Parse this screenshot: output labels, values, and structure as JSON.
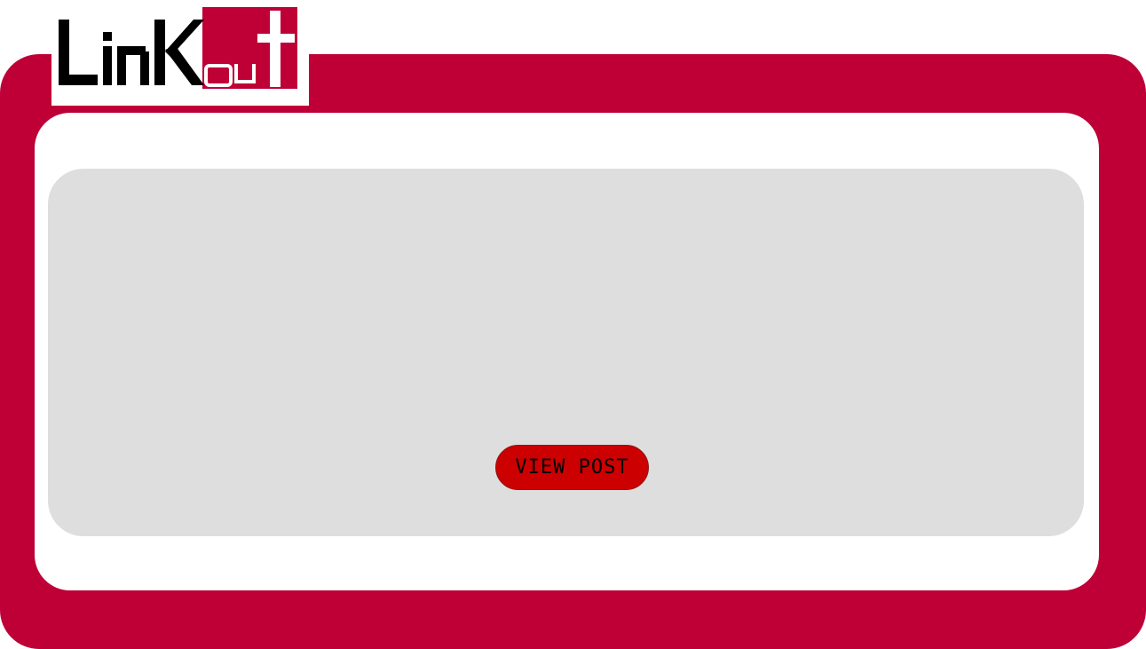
{
  "brand": {
    "logo_text_part1": "Link",
    "logo_text_part2": "out",
    "logo_icon": "linkout-logo",
    "accent_color": "#be0037",
    "logo_box_color": "#be0037"
  },
  "panel": {
    "background_color": "#dedede"
  },
  "actions": {
    "view_post_label": "VIEW POST",
    "button_color": "#cc0000"
  }
}
